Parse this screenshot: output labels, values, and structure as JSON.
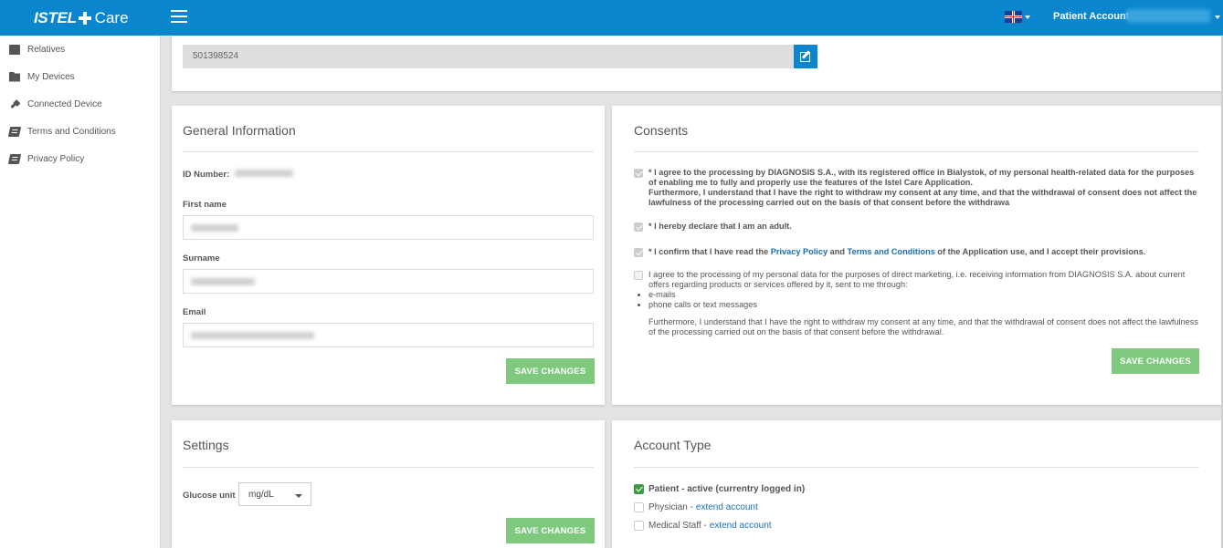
{
  "header": {
    "logo_brand": "ISTEL",
    "logo_product": "Care",
    "account_label": "Patient Account:",
    "language_icon": "uk-flag-icon",
    "menu_icon": "hamburger-icon"
  },
  "sidebar": {
    "items": [
      {
        "label": "Relatives",
        "icon": "briefcase-icon"
      },
      {
        "label": "My Devices",
        "icon": "folder-icon"
      },
      {
        "label": "Connected Device",
        "icon": "plug-icon"
      },
      {
        "label": "Terms and Conditions",
        "icon": "book-icon"
      },
      {
        "label": "Privacy Policy",
        "icon": "book-icon"
      }
    ]
  },
  "phone": {
    "value": "501398524",
    "edit_icon": "edit-icon"
  },
  "general": {
    "title": "General Information",
    "id_label": "ID Number:",
    "first_name_label": "First name",
    "surname_label": "Surname",
    "email_label": "Email",
    "save_label": "SAVE CHANGES"
  },
  "consents": {
    "title": "Consents",
    "c1_line1": "* I agree to the processing by DIAGNOSIS S.A., with its registered office in Bialystok, of my personal health-related data for the purposes of enabling me to fully and properly use the features of the Istel Care Application.",
    "c1_line2": "Furthermore, I understand that I have the right to withdraw my consent at any time, and that the withdrawal of consent does not affect the lawfulness of the processing carried out on the basis of that consent before the withdrawa",
    "c2": "* I hereby declare that I am an adult.",
    "c3_pre": "* I confirm that I have read the ",
    "c3_link1": "Privacy Policy",
    "c3_mid": " and ",
    "c3_link2": "Terms and Conditions",
    "c3_post": " of the Application use, and I accept their provisions.",
    "c4_intro": "I agree to the processing of my personal data for the purposes of direct marketing, i.e. receiving information from DIAGNOSIS S.A. about current offers regarding products or services offered by it, sent to me through:",
    "c4_items": [
      "e-mails",
      "phone calls or text messages"
    ],
    "c4_note": "Furthermore, I understand that I have the right to withdraw my consent at any time, and that the withdrawal of consent does not affect the lawfulness of the processing carried out on the basis of that consent before the withdrawal.",
    "save_label": "SAVE CHANGES"
  },
  "settings": {
    "title": "Settings",
    "glucose_label": "Glucose unit",
    "glucose_value": "mg/dL",
    "save_label": "SAVE CHANGES"
  },
  "account_type": {
    "title": "Account Type",
    "patient": "Patient - active (currentry logged in)",
    "physician": "Physician - ",
    "medical_staff": "Medical Staff - ",
    "extend_link": "extend account"
  },
  "colors": {
    "brand": "#0a86cf",
    "save_button": "#7fc97f",
    "link": "#1a6fb5",
    "active_check": "#3d9a47"
  }
}
